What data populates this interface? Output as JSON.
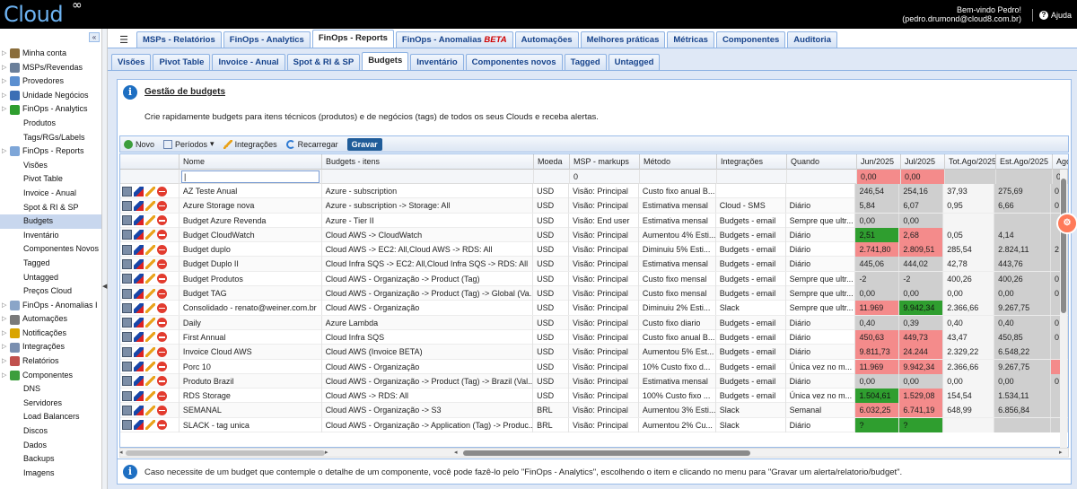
{
  "app": {
    "logo": "Cloud",
    "logo_mark": "∞"
  },
  "header": {
    "welcome": "Bem-vindo Pedro!",
    "email": "(pedro.drumond@cloud8.com.br)",
    "help": "Ajuda"
  },
  "sidebar": {
    "collapse": "«",
    "items": [
      {
        "label": "Minha conta",
        "level": 1,
        "icon": "user-icon",
        "color": "#8a6d3b"
      },
      {
        "label": "MSPs/Revendas",
        "level": 1,
        "icon": "users-icon",
        "color": "#6a7f9a"
      },
      {
        "label": "Provedores",
        "level": 1,
        "icon": "cloud-icon",
        "color": "#5b8fd0"
      },
      {
        "label": "Unidade Negócios",
        "level": 1,
        "icon": "org-icon",
        "color": "#3c6fb5"
      },
      {
        "label": "FinOps - Analytics",
        "level": 1,
        "icon": "dollar-icon",
        "color": "#2f9e2f"
      },
      {
        "label": "Produtos",
        "level": 2
      },
      {
        "label": "Tags/RGs/Labels",
        "level": 2
      },
      {
        "label": "FinOps - Reports",
        "level": 1,
        "icon": "report-icon",
        "color": "#7ea6d8"
      },
      {
        "label": "Visões",
        "level": 2
      },
      {
        "label": "Pivot Table",
        "level": 2
      },
      {
        "label": "Invoice - Anual",
        "level": 2
      },
      {
        "label": "Spot & RI & SP",
        "level": 2
      },
      {
        "label": "Budgets",
        "level": 2,
        "selected": true
      },
      {
        "label": "Inventário",
        "level": 2
      },
      {
        "label": "Componentes Novos",
        "level": 2
      },
      {
        "label": "Tagged",
        "level": 2
      },
      {
        "label": "Untagged",
        "level": 2
      },
      {
        "label": "Preços Cloud",
        "level": 2
      },
      {
        "label": "FinOps - Anomalias I",
        "level": 1,
        "icon": "anomaly-icon",
        "color": "#8aa5c8"
      },
      {
        "label": "Automações",
        "level": 1,
        "icon": "gear-icon",
        "color": "#7a7a7a"
      },
      {
        "label": "Notificações",
        "level": 1,
        "icon": "bell-icon",
        "color": "#d9a400"
      },
      {
        "label": "Integrações",
        "level": 1,
        "icon": "plug-icon",
        "color": "#7a8fb0"
      },
      {
        "label": "Relatórios",
        "level": 1,
        "icon": "chart-icon",
        "color": "#c0504d"
      },
      {
        "label": "Componentes",
        "level": 1,
        "icon": "puzzle-icon",
        "color": "#3c9e3c"
      },
      {
        "label": "DNS",
        "level": 2
      },
      {
        "label": "Servidores",
        "level": 2
      },
      {
        "label": "Load Balancers",
        "level": 2
      },
      {
        "label": "Discos",
        "level": 2
      },
      {
        "label": "Dados",
        "level": 2
      },
      {
        "label": "Backups",
        "level": 2
      },
      {
        "label": "Imagens",
        "level": 2
      }
    ]
  },
  "tabs_main": [
    {
      "label": "MSPs - Relatórios"
    },
    {
      "label": "FinOps - Analytics"
    },
    {
      "label": "FinOps - Reports",
      "active": true
    },
    {
      "label": "FinOps - Anomalias",
      "badge": "BETA"
    },
    {
      "label": "Automações"
    },
    {
      "label": "Melhores práticas"
    },
    {
      "label": "Métricas"
    },
    {
      "label": "Componentes"
    },
    {
      "label": "Auditoria"
    }
  ],
  "tabs_sub": [
    {
      "label": "Visões"
    },
    {
      "label": "Pivot Table"
    },
    {
      "label": "Invoice - Anual"
    },
    {
      "label": "Spot & RI & SP"
    },
    {
      "label": "Budgets",
      "active": true
    },
    {
      "label": "Inventário"
    },
    {
      "label": "Componentes novos"
    },
    {
      "label": "Tagged"
    },
    {
      "label": "Untagged"
    }
  ],
  "info": {
    "title": "Gestão de budgets",
    "description": "Crie rapidamente budgets para itens técnicos (produtos) e de negócios (tags) de todos os seus Clouds e receba alertas."
  },
  "toolbar": {
    "novo": "Novo",
    "periodos": "Períodos",
    "integracoes": "Integrações",
    "recarregar": "Recarregar",
    "gravar": "Gravar"
  },
  "grid": {
    "columns": [
      "Nome",
      "Budgets - itens",
      "Moeda",
      "MSP - markups",
      "Método",
      "Integrações",
      "Quando",
      "Jun/2025",
      "Jul/2025",
      "Tot.Ago/2025",
      "Est.Ago/2025",
      "Ago"
    ],
    "filter_row": {
      "msp": "0",
      "jun": "0,00",
      "jul": "0,00",
      "ago": "0"
    },
    "rows": [
      {
        "nome": "AZ Teste Anual",
        "itens": "Azure - subscription",
        "moeda": "USD",
        "msp": "Visão: Principal",
        "metodo": "Custo fixo anual B...",
        "integ": "",
        "quando": "",
        "jun": "246,54",
        "jul": "254,16",
        "tot": "37,93",
        "est": "275,69",
        "ago": "0",
        "jun_c": "gy",
        "jul_c": "gy",
        "est_c": "gy",
        "ago_c": "gy"
      },
      {
        "nome": "Azure Storage nova",
        "itens": "Azure - subscription -> Storage: All",
        "moeda": "USD",
        "msp": "Visão: Principal",
        "metodo": "Estimativa mensal",
        "integ": "Cloud - SMS",
        "quando": "Diário",
        "jun": "5,84",
        "jul": "6,07",
        "tot": "0,95",
        "est": "6,66",
        "ago": "0",
        "jun_c": "gy",
        "jul_c": "gy",
        "est_c": "gy",
        "ago_c": "gy"
      },
      {
        "nome": "Budget Azure Revenda",
        "itens": "Azure - Tier II",
        "moeda": "USD",
        "msp": "Visão: End user",
        "metodo": "Estimativa mensal",
        "integ": "Budgets - email",
        "quando": "Sempre que ultr...",
        "jun": "0,00",
        "jul": "0,00",
        "tot": "",
        "est": "",
        "ago": "",
        "jun_c": "gy",
        "jul_c": "gy",
        "est_c": "gy",
        "ago_c": "gy"
      },
      {
        "nome": "Budget CloudWatch",
        "itens": "Cloud AWS -> CloudWatch",
        "moeda": "USD",
        "msp": "Visão: Principal",
        "metodo": "Aumentou 4% Esti...",
        "integ": "Budgets - email",
        "quando": "Diário",
        "jun": "2,51",
        "jul": "2,68",
        "tot": "0,05",
        "est": "4,14",
        "ago": "",
        "jun_c": "g",
        "jul_c": "r",
        "est_c": "gy",
        "ago_c": "gy"
      },
      {
        "nome": "Budget duplo",
        "itens": "Cloud AWS -> EC2: All,Cloud AWS -> RDS: All",
        "moeda": "USD",
        "msp": "Visão: Principal",
        "metodo": "Diminuiu 5% Esti...",
        "integ": "Budgets - email",
        "quando": "Diário",
        "jun": "2.741,80",
        "jul": "2.809,51",
        "tot": "285,54",
        "est": "2.824,11",
        "ago": "2",
        "jun_c": "r",
        "jul_c": "r",
        "est_c": "gy",
        "ago_c": "gy"
      },
      {
        "nome": "Budget Duplo II",
        "itens": "Cloud Infra SQS -> EC2: All,Cloud Infra SQS -> RDS: All",
        "moeda": "USD",
        "msp": "Visão: Principal",
        "metodo": "Estimativa mensal",
        "integ": "Budgets - email",
        "quando": "Diário",
        "jun": "445,06",
        "jul": "444,02",
        "tot": "42,78",
        "est": "443,76",
        "ago": "",
        "jun_c": "gy",
        "jul_c": "gy",
        "est_c": "gy",
        "ago_c": "gy"
      },
      {
        "nome": "Budget Produtos",
        "itens": "Cloud AWS - Organização -> Product (Tag)",
        "moeda": "USD",
        "msp": "Visão: Principal",
        "metodo": "Custo fixo mensal",
        "integ": "Budgets - email",
        "quando": "Sempre que ultr...",
        "jun": "-2",
        "jul": "-2",
        "tot": "400,26",
        "est": "400,26",
        "ago": "0",
        "jun_c": "gy",
        "jul_c": "gy",
        "est_c": "gy",
        "ago_c": "gy"
      },
      {
        "nome": "Budget TAG",
        "itens": "Cloud AWS - Organização -> Product (Tag) -> Global (Va...",
        "moeda": "USD",
        "msp": "Visão: Principal",
        "metodo": "Custo fixo mensal",
        "integ": "Budgets - email",
        "quando": "Sempre que ultr...",
        "jun": "0,00",
        "jul": "0,00",
        "tot": "0,00",
        "est": "0,00",
        "ago": "0",
        "jun_c": "gy",
        "jul_c": "gy",
        "est_c": "gy",
        "ago_c": "gy"
      },
      {
        "nome": "Consolidado - renato@weiner.com.br",
        "itens": "Cloud AWS - Organização",
        "moeda": "USD",
        "msp": "Visão: Principal",
        "metodo": "Diminuiu 2% Esti...",
        "integ": "Slack",
        "quando": "Sempre que ultr...",
        "jun": "11.969",
        "jul": "9.942,34",
        "tot": "2.366,66",
        "est": "9.267,75",
        "ago": "",
        "jun_c": "r",
        "jul_c": "g",
        "est_c": "gy",
        "ago_c": "gy"
      },
      {
        "nome": "Daily",
        "itens": "Azure Lambda",
        "moeda": "USD",
        "msp": "Visão: Principal",
        "metodo": "Custo fixo diario",
        "integ": "Budgets - email",
        "quando": "Diário",
        "jun": "0,40",
        "jul": "0,39",
        "tot": "0,40",
        "est": "0,40",
        "ago": "0",
        "jun_c": "gy",
        "jul_c": "gy",
        "est_c": "gy",
        "ago_c": "gy"
      },
      {
        "nome": "First Annual",
        "itens": "Cloud Infra SQS",
        "moeda": "USD",
        "msp": "Visão: Principal",
        "metodo": "Custo fixo anual B...",
        "integ": "Budgets - email",
        "quando": "Diário",
        "jun": "450,63",
        "jul": "449,73",
        "tot": "43,47",
        "est": "450,85",
        "ago": "0",
        "jun_c": "r",
        "jul_c": "r",
        "est_c": "gy",
        "ago_c": "gy"
      },
      {
        "nome": "Invoice Cloud AWS",
        "itens": "Cloud AWS (Invoice BETA)",
        "moeda": "USD",
        "msp": "Visão: Principal",
        "metodo": "Aumentou 5% Est...",
        "integ": "Budgets - email",
        "quando": "Diário",
        "jun": "9.811,73",
        "jul": "24.244",
        "tot": "2.329,22",
        "est": "6.548,22",
        "ago": "",
        "jun_c": "r",
        "jul_c": "r",
        "est_c": "gy",
        "ago_c": "gy"
      },
      {
        "nome": "Porc 10",
        "itens": "Cloud AWS - Organização",
        "moeda": "USD",
        "msp": "Visão: Principal",
        "metodo": "10% Custo fixo d...",
        "integ": "Budgets - email",
        "quando": "Única vez no m...",
        "jun": "11.969",
        "jul": "9.942,34",
        "tot": "2.366,66",
        "est": "9.267,75",
        "ago": "",
        "jun_c": "r",
        "jul_c": "r",
        "est_c": "gy",
        "ago_c": "r"
      },
      {
        "nome": "Produto Brazil",
        "itens": "Cloud AWS - Organização -> Product (Tag) -> Brazil (Val...",
        "moeda": "USD",
        "msp": "Visão: Principal",
        "metodo": "Estimativa mensal",
        "integ": "Budgets - email",
        "quando": "Diário",
        "jun": "0,00",
        "jul": "0,00",
        "tot": "0,00",
        "est": "0,00",
        "ago": "0",
        "jun_c": "gy",
        "jul_c": "gy",
        "est_c": "gy",
        "ago_c": "gy"
      },
      {
        "nome": "RDS Storage",
        "itens": "Cloud AWS -> RDS: All",
        "moeda": "USD",
        "msp": "Visão: Principal",
        "metodo": "100% Custo fixo ...",
        "integ": "Budgets - email",
        "quando": "Única vez no m...",
        "jun": "1.504,61",
        "jul": "1.529,08",
        "tot": "154,54",
        "est": "1.534,11",
        "ago": "",
        "jun_c": "g",
        "jul_c": "r",
        "est_c": "gy",
        "ago_c": "gy"
      },
      {
        "nome": "SEMANAL",
        "itens": "Cloud AWS - Organização -> S3",
        "moeda": "BRL",
        "msp": "Visão: Principal",
        "metodo": "Aumentou 3% Esti...",
        "integ": "Slack",
        "quando": "Semanal",
        "jun": "6.032,25",
        "jul": "6.741,19",
        "tot": "648,99",
        "est": "6.856,84",
        "ago": "",
        "jun_c": "r",
        "jul_c": "r",
        "est_c": "gy",
        "ago_c": "gy"
      },
      {
        "nome": "SLACK - tag unica",
        "itens": "Cloud AWS - Organização -> Application (Tag) -> Produc...",
        "moeda": "BRL",
        "msp": "Visão: Principal",
        "metodo": "Aumentou 2% Cu...",
        "integ": "Slack",
        "quando": "Diário",
        "jun": "?",
        "jul": "?",
        "tot": "",
        "est": "",
        "ago": "",
        "jun_c": "g",
        "jul_c": "g",
        "est_c": "gy",
        "ago_c": "gy"
      }
    ]
  },
  "footer": {
    "text": "Caso necessite de um budget que contemple o detalhe de um componente, você pode fazê-lo pelo \"FinOps - Analytics\", escolhendo o item e clicando no menu para \"Gravar um alerta/relatorio/budget\"."
  },
  "colors": {
    "topbar": "#000000",
    "accent": "#15428b",
    "over_budget": "#f48b8b",
    "under_budget": "#2f9e2f"
  }
}
